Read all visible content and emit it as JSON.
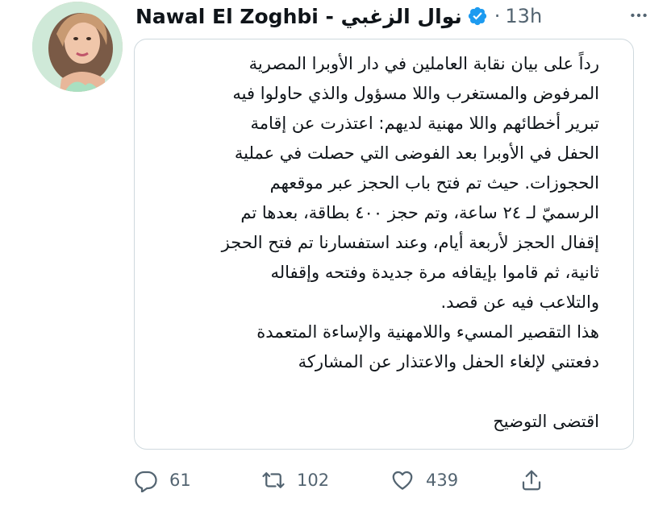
{
  "author": {
    "display_name": "Nawal El Zoghbi - نوال الزغبي",
    "verified": true,
    "separator": "·",
    "timestamp": "13h"
  },
  "more_icon": "more-horizontal-icon",
  "card": {
    "lines": [
      "رداً على بيان نقابة العاملين في دار الأوبرا المصرية",
      "المرفوض والمستغرب واللا مسؤول والذي حاولوا فيه",
      "تبرير أخطائهم واللا مهنية لديهم: اعتذرت عن إقامة",
      "الحفل في الأوبرا بعد الفوضى التي حصلت في عملية",
      "الحجوزات. حيث تم فتح باب الحجز عبر موقعهم",
      "الرسميّ لـ ٢٤ ساعة، وتم حجز ٤٠٠ بطاقة، بعدها تم",
      "إقفال الحجز لأربعة أيام، وعند استفسارنا تم فتح الحجز",
      "ثانية، ثم قاموا بإيقافه مرة جديدة وفتحه وإقفاله",
      "والتلاعب فيه عن قصد.",
      "هذا التقصير المسيء واللامهنية والإساءة المتعمدة",
      "دفعتني لإلغاء الحفل والاعتذار عن المشاركة"
    ],
    "closing": "اقتضى التوضيح"
  },
  "actions": {
    "replies": "61",
    "retweets": "102",
    "likes": "439"
  },
  "colors": {
    "text": "#0f1419",
    "muted": "#536471",
    "border": "#cfd9de",
    "verified_blue": "#1d9bf0"
  }
}
